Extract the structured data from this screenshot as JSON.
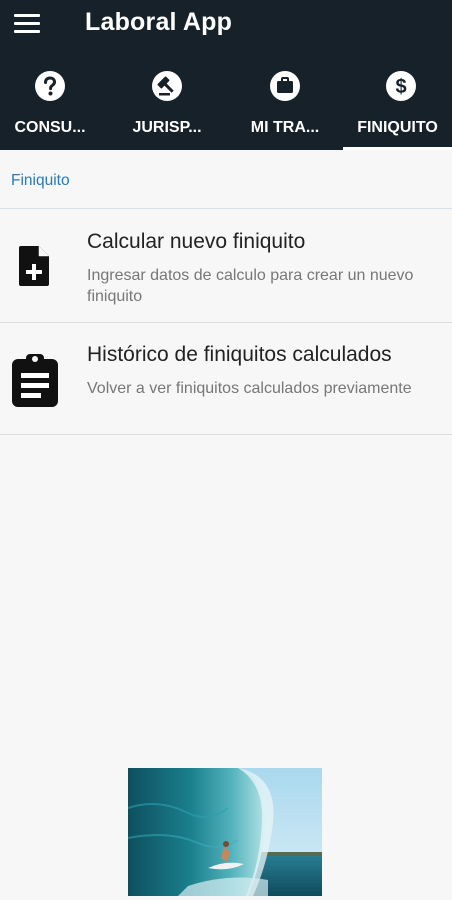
{
  "app": {
    "title": "Laboral App",
    "menu_icon": "hamburger-menu-icon"
  },
  "tabs": [
    {
      "label": "CONSU...",
      "icon": "question-circle-icon",
      "active": false
    },
    {
      "label": "JURISP...",
      "icon": "gavel-circle-icon",
      "active": false
    },
    {
      "label": "MI TRA...",
      "icon": "briefcase-circle-icon",
      "active": false
    },
    {
      "label": "FINIQUITO",
      "icon": "dollar-circle-icon",
      "active": true
    }
  ],
  "breadcrumb": "Finiquito",
  "items": [
    {
      "title": "Calcular nuevo finiquito",
      "subtitle": "Ingresar datos de calculo para crear un nuevo finiquito",
      "icon": "add-document-icon"
    },
    {
      "title": "Histórico de finiquitos calculados",
      "subtitle": "Volver a ver finiquitos calculados previamente",
      "icon": "clipboard-icon"
    }
  ],
  "ad": {
    "image": "surfer-wave-photo"
  },
  "colors": {
    "appbar": "#162129",
    "accent": "#2979b8",
    "background": "#f7f7f7"
  }
}
